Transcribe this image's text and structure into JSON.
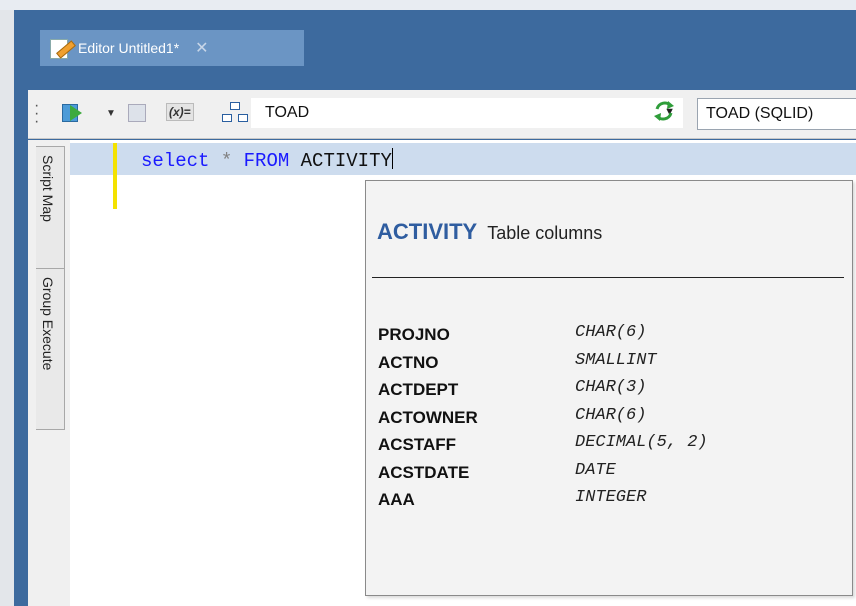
{
  "editor_tab": {
    "title": "Editor Untitled1*",
    "close": "✕"
  },
  "toolbar": {
    "vars_label": "(x)=",
    "schema_value": "TOAD",
    "schema_arrow": "▼",
    "connection_value": "TOAD (SQLID)"
  },
  "side_tabs": [
    "Script Map",
    "Group Execute"
  ],
  "code": {
    "kw_select": "select",
    "star": "*",
    "kw_from": "FROM",
    "table": "ACTIVITY"
  },
  "popup": {
    "table_name": "ACTIVITY",
    "subtitle": "Table columns",
    "columns": [
      {
        "name": "PROJNO",
        "type": "CHAR(6)"
      },
      {
        "name": "ACTNO",
        "type": "SMALLINT"
      },
      {
        "name": "ACTDEPT",
        "type": "CHAR(3)"
      },
      {
        "name": "ACTOWNER",
        "type": "CHAR(6)"
      },
      {
        "name": "ACSTAFF",
        "type": "DECIMAL(5, 2)"
      },
      {
        "name": "ACSTDATE",
        "type": "DATE"
      },
      {
        "name": "AAA",
        "type": "INTEGER"
      }
    ]
  },
  "colors": {
    "background": "#3d6a9e",
    "tab": "#6b95c4",
    "keyword": "#1a1aff",
    "popup_title": "#2f5da0",
    "current_line": "#cddcee",
    "change_marker": "#f4e200"
  },
  "icons": [
    "editor-pencil-icon",
    "execute-icon",
    "explain-plan-icon",
    "bind-variables-icon",
    "schema-browser-icon",
    "refresh-icon"
  ]
}
